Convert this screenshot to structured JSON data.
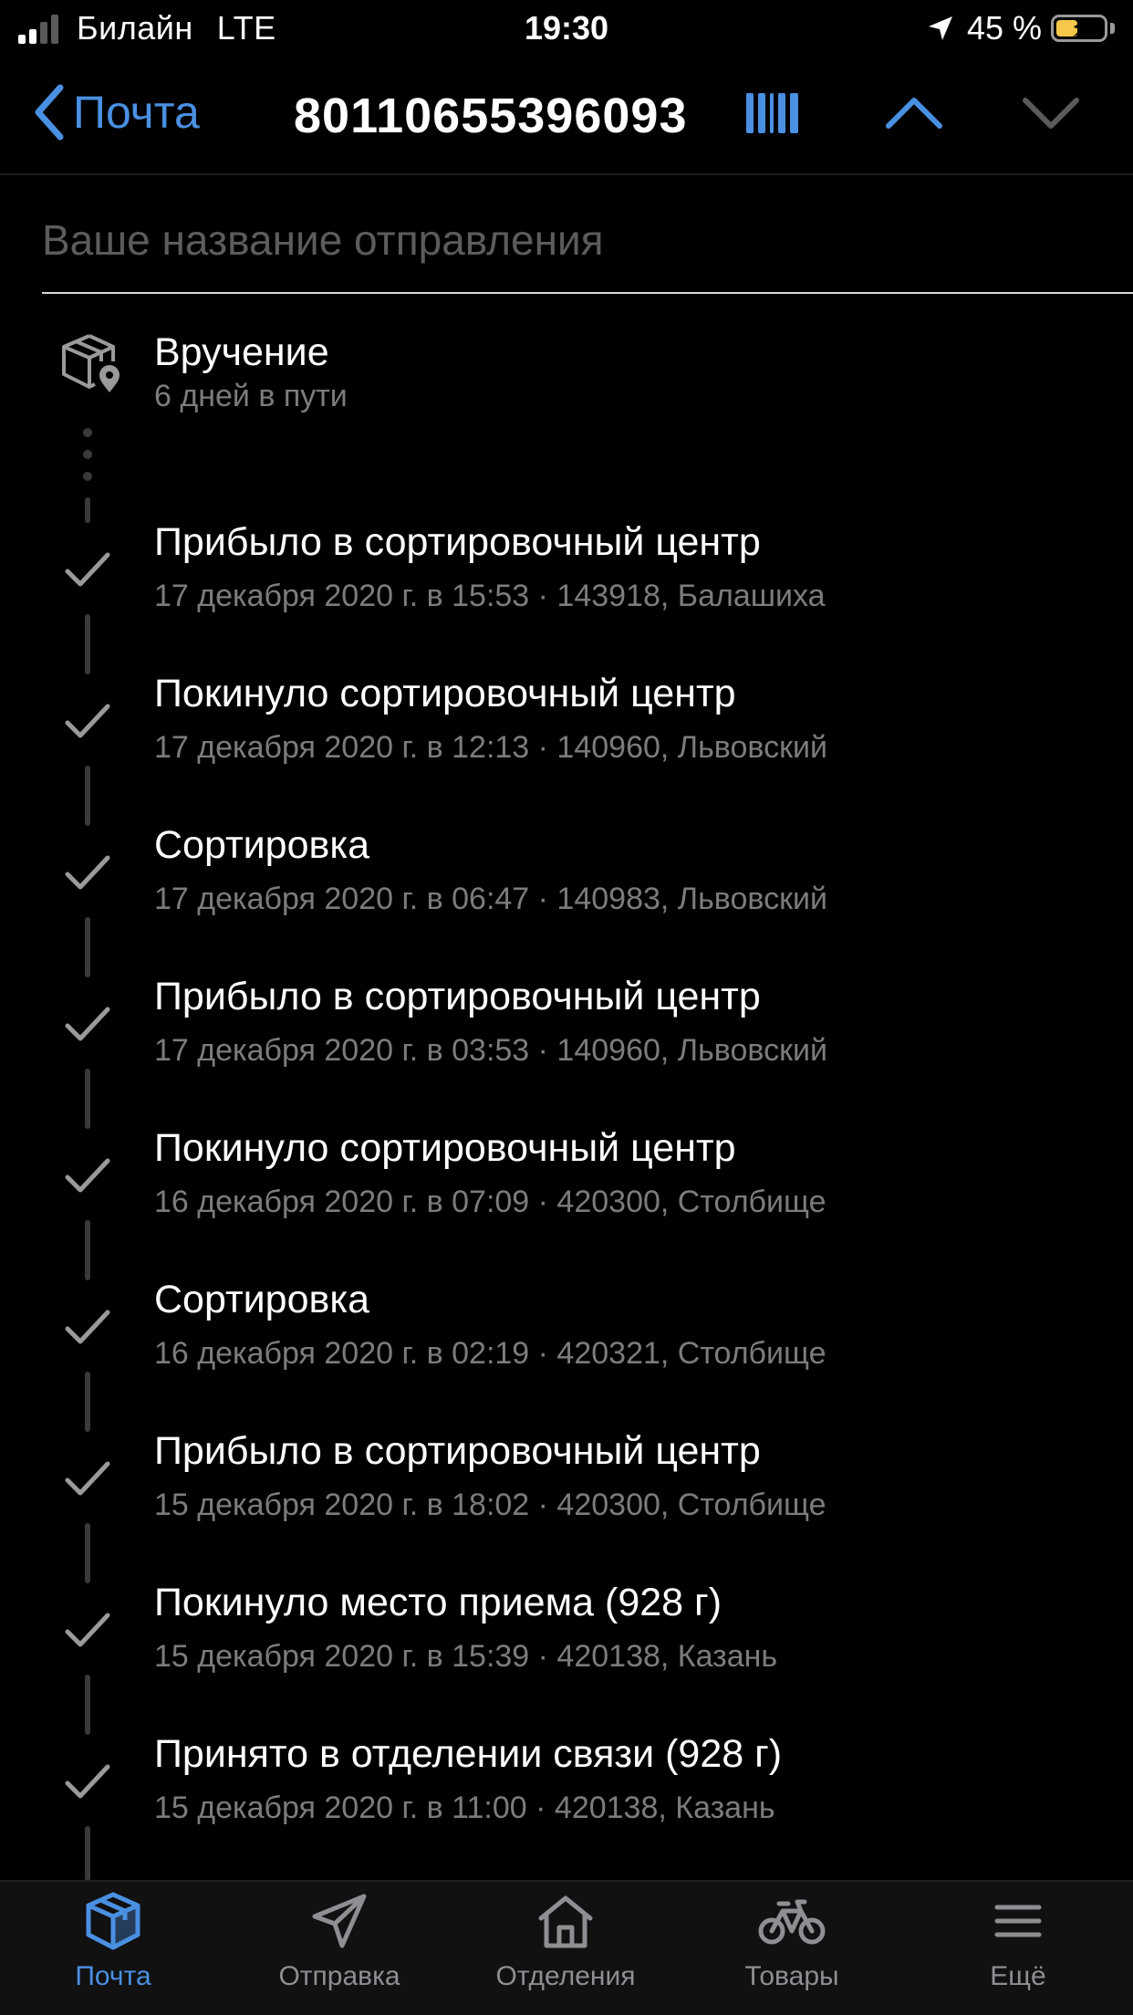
{
  "status_bar": {
    "carrier": "Билайн",
    "network": "LTE",
    "time": "19:30",
    "battery": "45 %",
    "battery_level": 45
  },
  "nav": {
    "back_label": "Почта",
    "title": "80110655396093",
    "accent_color": "#4a90e2"
  },
  "name_field": {
    "placeholder": "Ваше название отправления",
    "value": ""
  },
  "delivery": {
    "title": "Вручение",
    "subtitle": "6 дней в пути"
  },
  "events": [
    {
      "title": "Прибыло в сортировочный центр",
      "detail": "17 декабря 2020 г. в 15:53 · 143918, Балашиха"
    },
    {
      "title": "Покинуло сортировочный центр",
      "detail": "17 декабря 2020 г. в 12:13 · 140960, Львовский"
    },
    {
      "title": "Сортировка",
      "detail": "17 декабря 2020 г. в 06:47 · 140983, Львовский"
    },
    {
      "title": "Прибыло в сортировочный центр",
      "detail": "17 декабря 2020 г. в 03:53 · 140960, Львовский"
    },
    {
      "title": "Покинуло сортировочный центр",
      "detail": "16 декабря 2020 г. в 07:09 · 420300, Столбище"
    },
    {
      "title": "Сортировка",
      "detail": "16 декабря 2020 г. в 02:19 · 420321, Столбище"
    },
    {
      "title": "Прибыло в сортировочный центр",
      "detail": "15 декабря 2020 г. в 18:02 · 420300, Столбище"
    },
    {
      "title": "Покинуло место приема  (928 г)",
      "detail": "15 декабря 2020 г. в 15:39 · 420138, Казань"
    },
    {
      "title": "Принято в отделении связи  (928 г)",
      "detail": "15 декабря 2020 г. в 11:00 · 420138, Казань"
    }
  ],
  "tabs": [
    {
      "label": "Почта",
      "icon": "box-icon",
      "active": true
    },
    {
      "label": "Отправка",
      "icon": "paper-plane-icon",
      "active": false
    },
    {
      "label": "Отделения",
      "icon": "house-icon",
      "active": false
    },
    {
      "label": "Товары",
      "icon": "bicycle-icon",
      "active": false
    },
    {
      "label": "Ещё",
      "icon": "menu-icon",
      "active": false
    }
  ]
}
